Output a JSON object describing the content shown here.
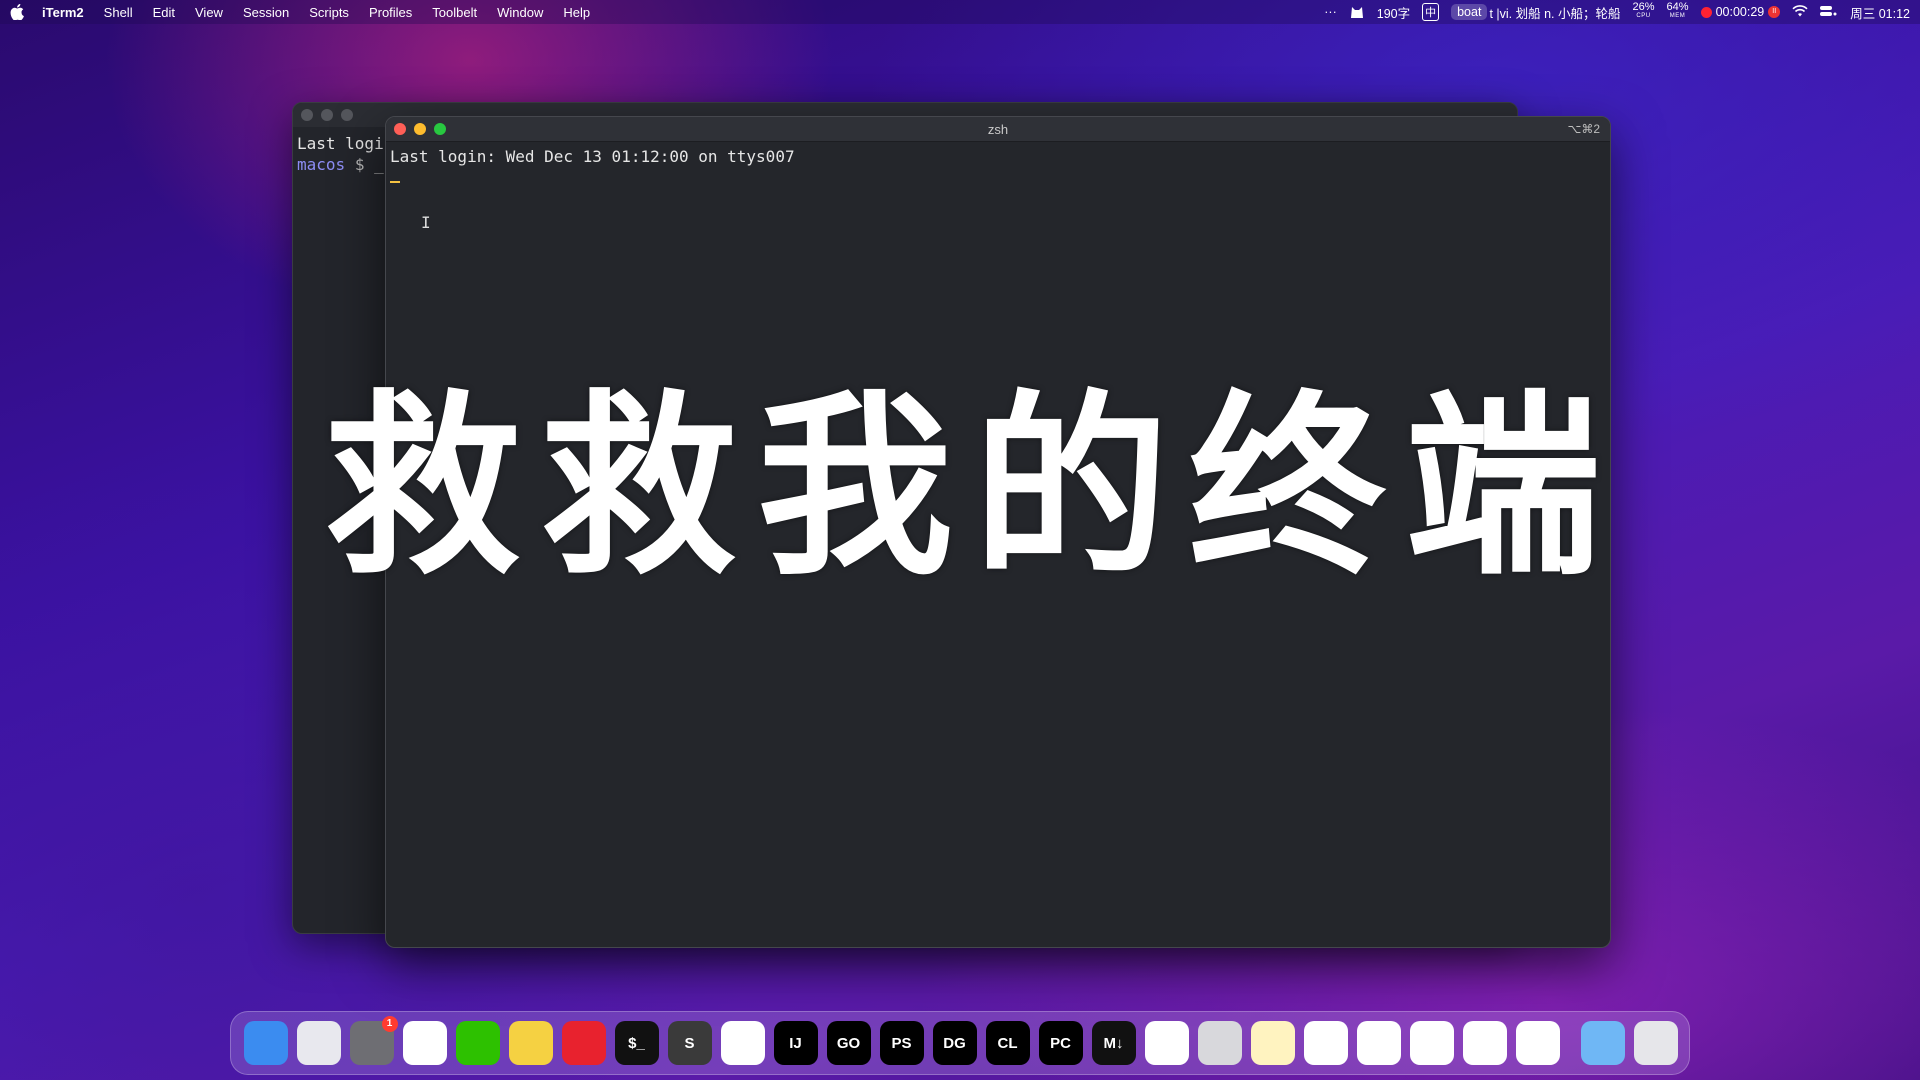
{
  "menubar": {
    "app_name": "iTerm2",
    "menus": [
      "Shell",
      "Edit",
      "View",
      "Session",
      "Scripts",
      "Profiles",
      "Toolbelt",
      "Window",
      "Help"
    ],
    "status": {
      "overflow": "···",
      "word_count": "190字",
      "input_method": "中",
      "dict_word": "boat",
      "dict_def": "t |vi. 划船 n. 小船；轮船",
      "cpu_value": "26%",
      "cpu_label": "CPU",
      "mem_value": "64%",
      "mem_label": "MEM",
      "record_time": "00:00:29",
      "pause_label": "II",
      "datetime": "周三 01:12"
    }
  },
  "back_window": {
    "line1": "Last logi",
    "prompt_name": "macos",
    "prompt_sym": "$ _"
  },
  "front_window": {
    "title": "zsh",
    "shortcut": "⌥⌘2",
    "line1": "Last login: Wed Dec 13 01:12:00 on ttys007"
  },
  "overlay_caption": "救救我的终端",
  "dock": {
    "items": [
      {
        "label": "",
        "color": "#3b8cf0",
        "icon": "finder-icon"
      },
      {
        "label": "",
        "color": "#e8e8ee",
        "icon": "launchpad-icon"
      },
      {
        "label": "",
        "color": "#6e6e73",
        "icon": "system-settings-icon",
        "badge": "1"
      },
      {
        "label": "",
        "color": "#ffffff",
        "icon": "chrome-icon"
      },
      {
        "label": "",
        "color": "#2dc100",
        "icon": "wechat-icon"
      },
      {
        "label": "",
        "color": "#f5d142",
        "icon": "app-green-yellow-icon"
      },
      {
        "label": "",
        "color": "#e8222e",
        "icon": "netease-music-icon"
      },
      {
        "label": "$_",
        "color": "#111111",
        "icon": "terminal-icon"
      },
      {
        "label": "S",
        "color": "#3a3a3a",
        "icon": "sublime-text-icon"
      },
      {
        "label": "",
        "color": "#ffffff",
        "icon": "vscode-icon"
      },
      {
        "label": "IJ",
        "color": "#000000",
        "icon": "intellij-icon"
      },
      {
        "label": "GO",
        "color": "#000000",
        "icon": "goland-icon"
      },
      {
        "label": "PS",
        "color": "#000000",
        "icon": "phpstorm-icon"
      },
      {
        "label": "DG",
        "color": "#000000",
        "icon": "datagrip-icon"
      },
      {
        "label": "CL",
        "color": "#000000",
        "icon": "clion-icon"
      },
      {
        "label": "PC",
        "color": "#000000",
        "icon": "pycharm-icon"
      },
      {
        "label": "M↓",
        "color": "#111111",
        "icon": "markdown-icon"
      },
      {
        "label": "",
        "color": "#ffffff",
        "icon": "git-icon"
      },
      {
        "label": "",
        "color": "#d8d8dc",
        "icon": "database-icon"
      },
      {
        "label": "",
        "color": "#fff3c0",
        "icon": "pawprint-icon"
      },
      {
        "label": "",
        "color": "#ffffff",
        "icon": "star-app-icon"
      },
      {
        "label": "",
        "color": "#ffffff",
        "icon": "pen-icon"
      },
      {
        "label": "",
        "color": "#ffffff",
        "icon": "blue-square-icon"
      },
      {
        "label": "",
        "color": "#ffffff",
        "icon": "blue-arrow-icon"
      },
      {
        "label": "",
        "color": "#ffffff",
        "icon": "acrobat-icon"
      }
    ],
    "folder_color": "#6fb7f5",
    "trash_color": "#e6e6ea"
  }
}
